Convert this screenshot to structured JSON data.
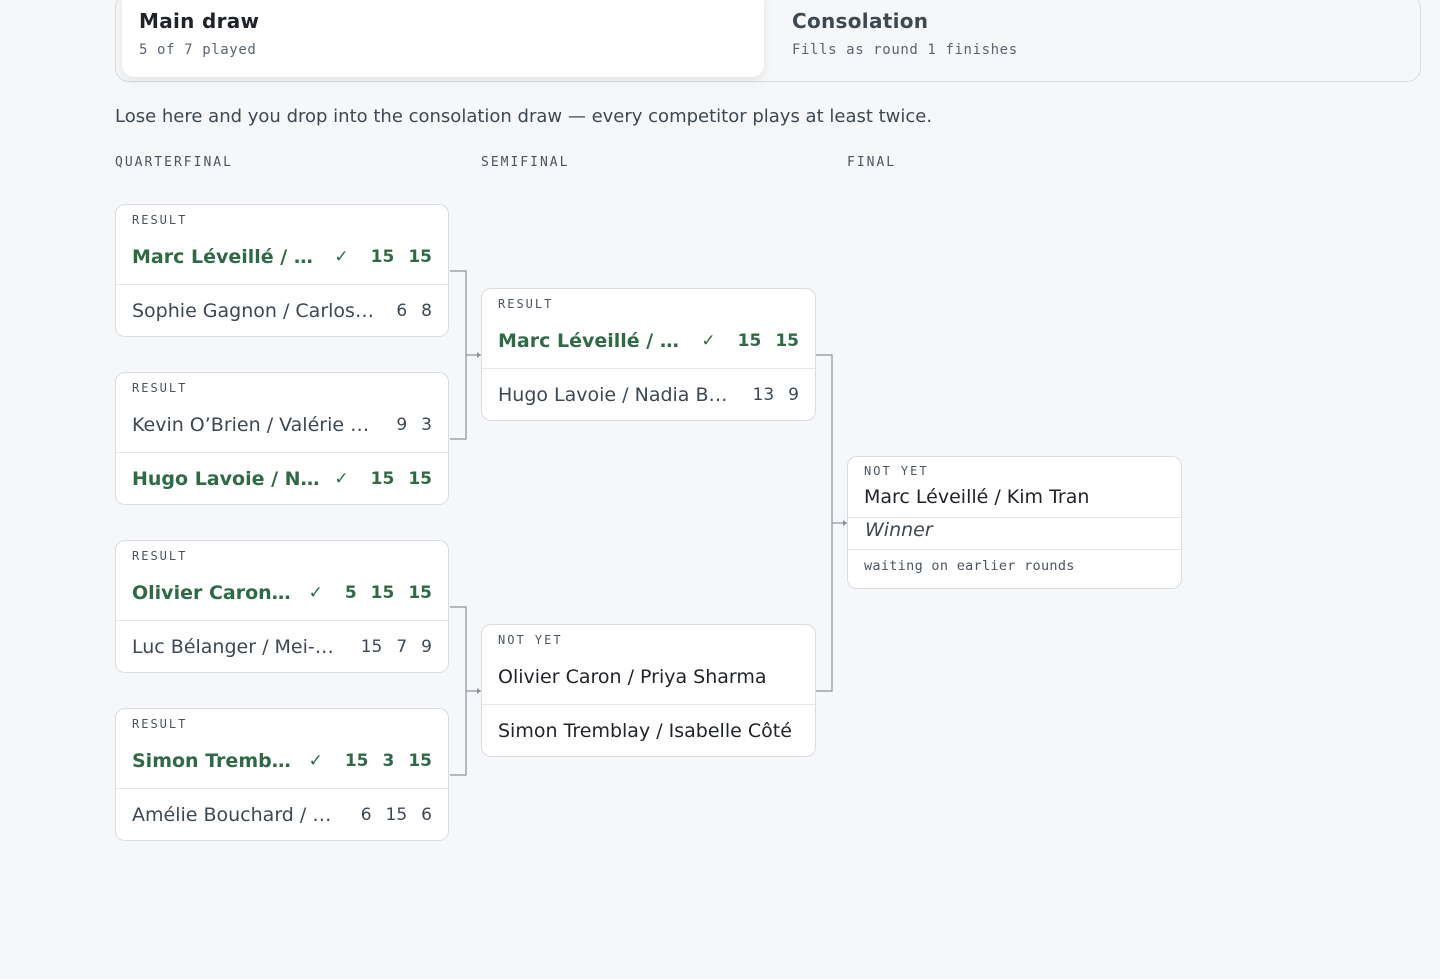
{
  "tabs": [
    {
      "title": "Main draw",
      "subtitle": "5 of 7 played"
    },
    {
      "title": "Consolation",
      "subtitle": "Fills as round 1 finishes"
    }
  ],
  "intro": "Lose here and you drop into the consolation draw — every competitor plays at least twice.",
  "rounds": [
    "QUARTERFINAL",
    "SEMIFINAL",
    "FINAL"
  ],
  "check_glyph": "✓",
  "quarterfinals": [
    {
      "status": "RESULT",
      "top": {
        "name": "Marc Léveillé / Kim Tran",
        "scores": [
          "15",
          "15"
        ],
        "winner": true
      },
      "bottom": {
        "name": "Sophie Gagnon / Carlos Mendes",
        "scores": [
          "6",
          "8"
        ],
        "winner": false
      }
    },
    {
      "status": "RESULT",
      "top": {
        "name": "Kevin O’Brien / Valérie Dubois",
        "scores": [
          "9",
          "3"
        ],
        "winner": false
      },
      "bottom": {
        "name": "Hugo Lavoie / Nadia Benali",
        "scores": [
          "15",
          "15"
        ],
        "winner": true
      }
    },
    {
      "status": "RESULT",
      "top": {
        "name": "Olivier Caron / Priya Sharma",
        "scores": [
          "5",
          "15",
          "15"
        ],
        "winner": true
      },
      "bottom": {
        "name": "Luc Bélanger / Mei-Ling Wu",
        "scores": [
          "15",
          "7",
          "9"
        ],
        "winner": false
      }
    },
    {
      "status": "RESULT",
      "top": {
        "name": "Simon Tremblay / Isabelle Côté",
        "scores": [
          "15",
          "3",
          "15"
        ],
        "winner": true
      },
      "bottom": {
        "name": "Amélie Bouchard / Denis Roy",
        "scores": [
          "6",
          "15",
          "6"
        ],
        "winner": false
      }
    }
  ],
  "semifinals": [
    {
      "status": "RESULT",
      "top": {
        "name": "Marc Léveillé / Kim Tran",
        "scores": [
          "15",
          "15"
        ],
        "winner": true
      },
      "bottom": {
        "name": "Hugo Lavoie / Nadia Benali",
        "scores": [
          "13",
          "9"
        ],
        "winner": false
      }
    },
    {
      "status": "NOT YET",
      "top": {
        "name": "Olivier Caron / Priya Sharma",
        "scores": [],
        "winner": false
      },
      "bottom": {
        "name": "Simon Tremblay / Isabelle Côté",
        "scores": [],
        "winner": false
      }
    }
  ],
  "final": {
    "status": "NOT YET",
    "top_name": "Marc Léveillé / Kim Tran",
    "bottom_name": "Winner",
    "note": "waiting on earlier rounds"
  }
}
